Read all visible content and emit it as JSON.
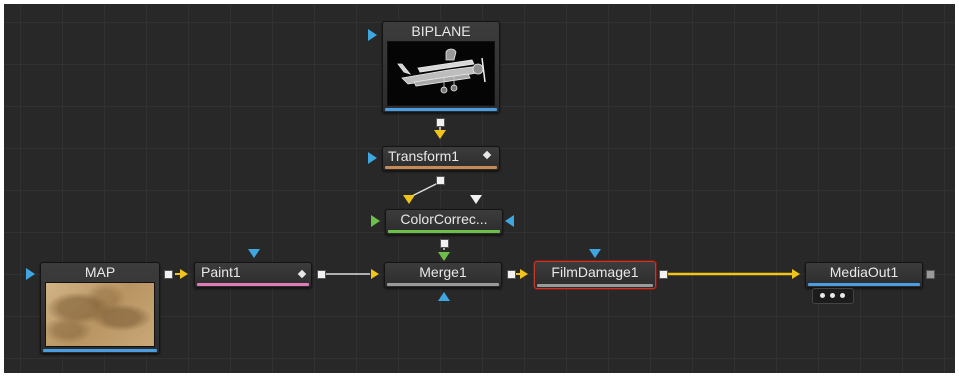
{
  "graph": {
    "nodes": [
      {
        "id": "biplane",
        "label": "BIPLANE",
        "icon": "biplane-thumbnail",
        "color": "#4a9de0"
      },
      {
        "id": "transform1",
        "label": "Transform1",
        "icon": "diamond-icon",
        "color": "#c58a55"
      },
      {
        "id": "colorcorrector",
        "label": "ColorCorrec...",
        "color": "#6cc04a"
      },
      {
        "id": "map",
        "label": "MAP",
        "icon": "map-thumbnail",
        "color": "#4a9de0"
      },
      {
        "id": "paint1",
        "label": "Paint1",
        "icon": "diamond-icon",
        "color": "#e07ab8"
      },
      {
        "id": "merge1",
        "label": "Merge1",
        "color": "#9a9a9a"
      },
      {
        "id": "filmdamage1",
        "label": "FilmDamage1",
        "color": "#9a9a9a",
        "selected": true
      },
      {
        "id": "mediaout1",
        "label": "MediaOut1",
        "color": "#4a9de0"
      }
    ],
    "colors": {
      "background": "#282828",
      "wire_yellow": "#f0c419",
      "input_blue": "#3fa7e0",
      "input_green": "#6cc04a",
      "selection_red": "#c0392b"
    }
  }
}
